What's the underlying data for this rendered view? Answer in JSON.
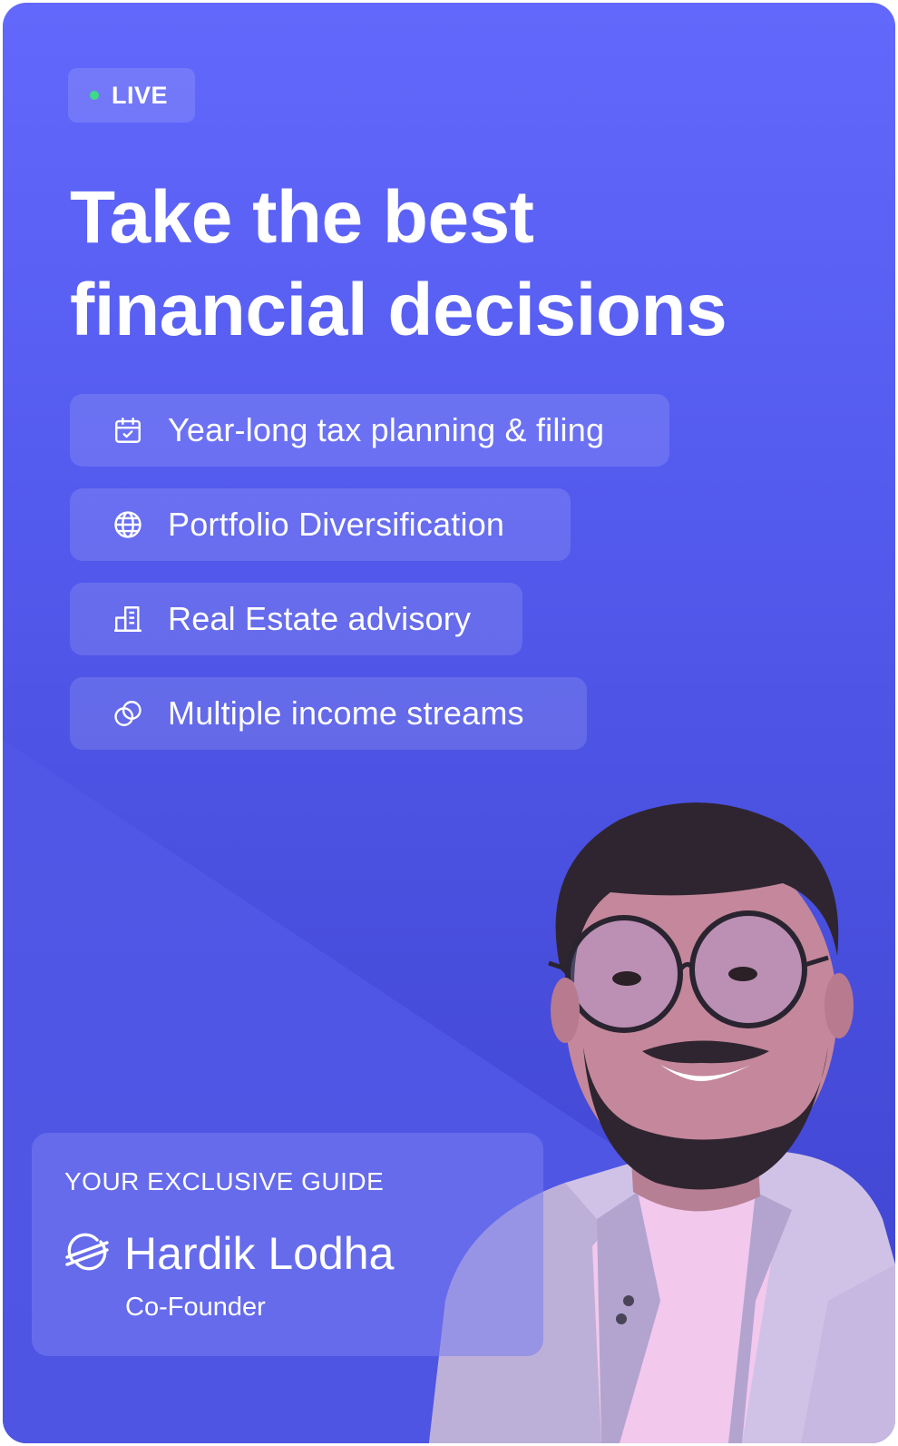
{
  "badge": {
    "label": "LIVE",
    "dot_color": "#3ddc84"
  },
  "headline": {
    "line1": "Take the best",
    "line2": "financial decisions"
  },
  "features": [
    {
      "icon": "calendar-check-icon",
      "label": "Year-long tax planning & filing"
    },
    {
      "icon": "globe-icon",
      "label": "Portfolio Diversification"
    },
    {
      "icon": "building-icon",
      "label": "Real Estate advisory"
    },
    {
      "icon": "linked-circles-icon",
      "label": "Multiple income streams"
    }
  ],
  "guide": {
    "kicker": "YOUR EXCLUSIVE GUIDE",
    "logo": "stellar-logo-icon",
    "name": "Hardik Lodha",
    "role": "Co-Founder"
  },
  "colors": {
    "bg_top": "#6268fb",
    "bg_bottom": "#3f43cf",
    "text": "#ffffff"
  }
}
